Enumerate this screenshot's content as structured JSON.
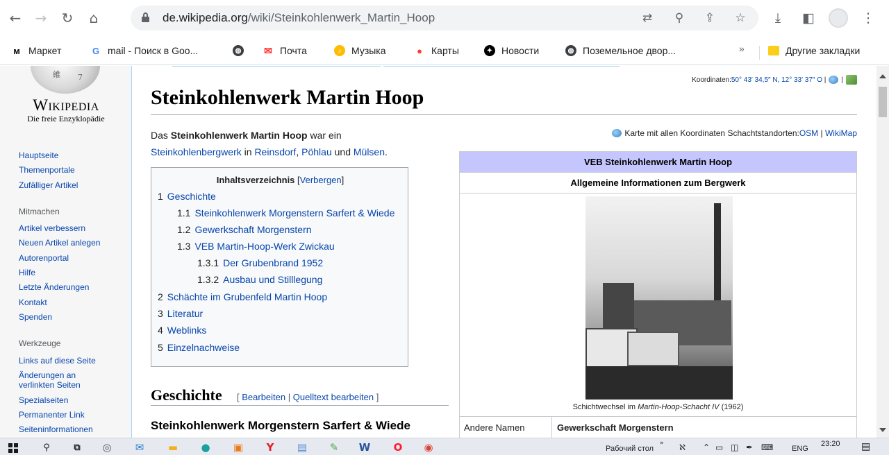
{
  "browser": {
    "url_host": "de.wikipedia.org",
    "url_path": "/wiki/Steinkohlenwerk_Martin_Hoop",
    "bookmarks": [
      {
        "label": "Маркет",
        "icon": "yandex-market-icon",
        "color": "#ffcc00"
      },
      {
        "label": "mail - Поиск в Goo...",
        "icon": "google-icon",
        "color": "#4285f4"
      },
      {
        "label": "",
        "icon": "globe-icon",
        "color": "#3c4043"
      },
      {
        "label": "Почта",
        "icon": "mail-icon",
        "color": "#ff3333"
      },
      {
        "label": "Музыка",
        "icon": "music-icon",
        "color": "#ffbc00"
      },
      {
        "label": "Карты",
        "icon": "map-pin-icon",
        "color": "#ff3b30"
      },
      {
        "label": "Новости",
        "icon": "news-icon",
        "color": "#000000"
      },
      {
        "label": "Поземельное двор...",
        "icon": "globe-icon",
        "color": "#3c4043"
      }
    ],
    "more_bookmarks": "»",
    "other_bookmarks": "Другие закладки"
  },
  "sidebar": {
    "wordmark": "Wikipedia",
    "tagline": "Die freie Enzyklopädie",
    "nav": [
      "Hauptseite",
      "Themenportale",
      "Zufälliger Artikel"
    ],
    "mitmachen_head": "Mitmachen",
    "mitmachen": [
      "Artikel verbessern",
      "Neuen Artikel anlegen",
      "Autorenportal",
      "Hilfe",
      "Letzte Änderungen",
      "Kontakt",
      "Spenden"
    ],
    "werkzeuge_head": "Werkzeuge",
    "werkzeuge": [
      "Links auf diese Seite",
      "Änderungen an",
      "verlinkten Seiten",
      "Spezialseiten",
      "Permanenter Link",
      "Seiteninformationen"
    ]
  },
  "article": {
    "coords_label": "Koordinaten: ",
    "coords_value": "50° 43′ 34,5″ N, 12° 33′ 37″ O",
    "title": "Steinkohlenwerk Martin Hoop",
    "intro_1": "Das ",
    "intro_bold": "Steinkohlenwerk Martin Hoop",
    "intro_2": " war ein",
    "intro_link_1": "Steinkohlenbergwerk",
    "intro_in": " in ",
    "intro_link_2": "Reinsdorf",
    "intro_comma": ", ",
    "intro_link_3": "Pöhlau",
    "intro_und": " und ",
    "intro_link_4": "Mülsen",
    "intro_end": ".",
    "maplink_text": "Karte mit allen Koordinaten Schachtstandorten: ",
    "maplink_osm": "OSM",
    "maplink_sep": " | ",
    "maplink_wikimap": "WikiMap",
    "toc_title": "Inhaltsverzeichnis",
    "toc_hide": "Verbergen",
    "toc": [
      {
        "num": "1",
        "label": "Geschichte"
      },
      {
        "num": "1.1",
        "label": "Steinkohlenwerk Morgenstern Sarfert & Wiede"
      },
      {
        "num": "1.2",
        "label": "Gewerkschaft Morgenstern"
      },
      {
        "num": "1.3",
        "label": "VEB Martin-Hoop-Werk Zwickau"
      },
      {
        "num": "1.3.1",
        "label": "Der Grubenbrand 1952"
      },
      {
        "num": "1.3.2",
        "label": "Ausbau und Stilllegung"
      },
      {
        "num": "2",
        "label": "Schächte im Grubenfeld Martin Hoop"
      },
      {
        "num": "3",
        "label": "Literatur"
      },
      {
        "num": "4",
        "label": "Weblinks"
      },
      {
        "num": "5",
        "label": "Einzelnachweise"
      }
    ],
    "h_geschichte": "Geschichte",
    "edit_link": "Bearbeiten",
    "edit_sep": " | ",
    "source_edit_link": "Quelltext bearbeiten",
    "h_sub": "Steinkohlenwerk Morgenstern Sarfert & Wiede"
  },
  "infobox": {
    "title": "VEB Steinkohlenwerk Martin Hoop",
    "subtitle": "Allgemeine Informationen zum Bergwerk",
    "caption_1": "Schichtwechsel im ",
    "caption_italic": "Martin-Hoop-Schacht IV",
    "caption_2": " (1962)",
    "row_key": "Andere Namen",
    "row_value": "Gewerkschaft Morgenstern",
    "title_bg": "#c6c6ff"
  },
  "taskbar": {
    "desktop_label": "Рабочий стол",
    "lang": "ENG",
    "time": "23:20"
  }
}
